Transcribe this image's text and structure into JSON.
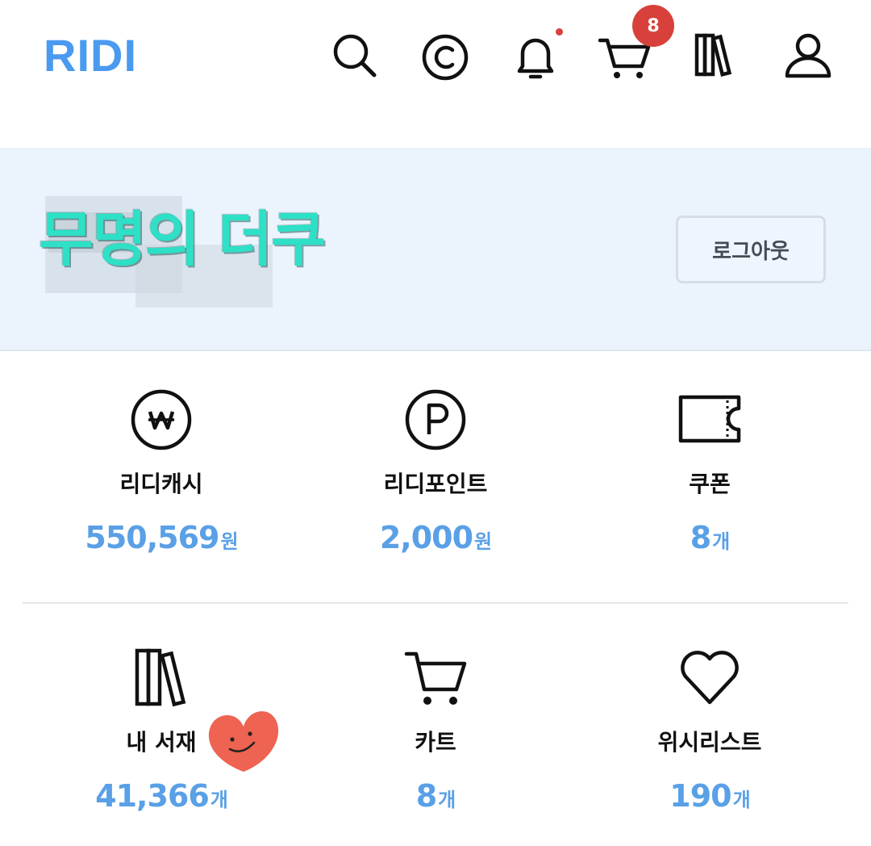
{
  "header": {
    "logo": "RIDI",
    "cart_badge": "8",
    "icons": [
      "search-icon",
      "ridicash-icon",
      "bell-icon",
      "cart-icon",
      "library-icon",
      "user-icon"
    ]
  },
  "profile": {
    "username": "무명의 더쿠",
    "logout_label": "로그아웃"
  },
  "stats": [
    {
      "label": "리디캐시",
      "value": "550,569",
      "unit": "원",
      "icon": "won-icon"
    },
    {
      "label": "리디포인트",
      "value": "2,000",
      "unit": "원",
      "icon": "point-icon"
    },
    {
      "label": "쿠폰",
      "value": "8",
      "unit": "개",
      "icon": "coupon-icon"
    },
    {
      "label": "내 서재",
      "value": "41,366",
      "unit": "개",
      "icon": "library-icon"
    },
    {
      "label": "카트",
      "value": "8",
      "unit": "개",
      "icon": "cart-icon"
    },
    {
      "label": "위시리스트",
      "value": "190",
      "unit": "개",
      "icon": "heart-icon"
    }
  ],
  "colors": {
    "brand": "#4a9af0",
    "value": "#5aa0e6",
    "badge": "#d8413b",
    "banner_bg": "#ebf3fd",
    "username": "#2de0c6"
  }
}
